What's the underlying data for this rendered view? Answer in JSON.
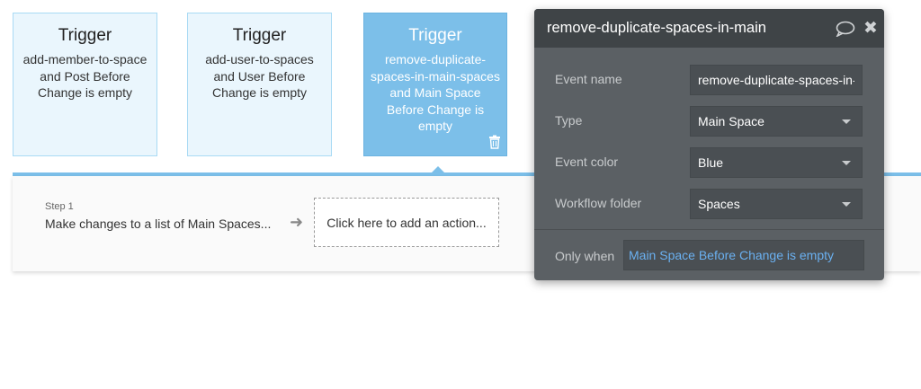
{
  "triggers": [
    {
      "title": "Trigger",
      "lines": [
        "add-member-to-space",
        "and Post Before",
        "Change is empty"
      ]
    },
    {
      "title": "Trigger",
      "lines": [
        "add-user-to-spaces",
        "and User Before",
        "Change is empty"
      ]
    },
    {
      "title": "Trigger",
      "lines": [
        "remove-duplicate-",
        "spaces-in-main-spaces",
        "and Main Space",
        "Before Change is",
        "empty"
      ]
    }
  ],
  "step": {
    "label": "Step 1",
    "name": "Make changes to a list of Main Spaces..."
  },
  "add_action_label": "Click here to add an action...",
  "properties": {
    "title": "remove-duplicate-spaces-in-main",
    "event_name_label": "Event name",
    "event_name_value": "remove-duplicate-spaces-in-main",
    "type_label": "Type",
    "type_value": "Main Space",
    "event_color_label": "Event color",
    "event_color_value": "Blue",
    "workflow_folder_label": "Workflow folder",
    "workflow_folder_value": "Spaces",
    "only_when_label": "Only when",
    "only_when_value": "Main Space Before Change is empty"
  },
  "colors": {
    "accent": "#7cbfe9",
    "panel": "#5b6064",
    "expression": "#6ab0f0"
  }
}
